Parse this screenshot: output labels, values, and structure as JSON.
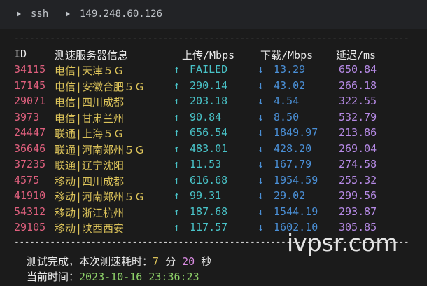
{
  "titlebar": {
    "app": "ssh",
    "host": "149.248.60.126"
  },
  "table": {
    "rule": "--------------------------------------------------------------------------------------",
    "headers": {
      "id": "ID",
      "node": "测速服务器信息",
      "upload": "上传/Mbps",
      "download": "下载/Mbps",
      "latency": "延迟/ms"
    },
    "up_arrow": "↑",
    "down_arrow": "↓",
    "rows": [
      {
        "id": "34115",
        "node": "电信|天津５Ｇ",
        "upload": "FAILED",
        "download": "13.29",
        "latency": "650.84"
      },
      {
        "id": "17145",
        "node": "电信|安徽合肥５Ｇ",
        "upload": "290.14",
        "download": "43.02",
        "latency": "266.18"
      },
      {
        "id": "29071",
        "node": "电信|四川成都",
        "upload": "203.18",
        "download": "4.54",
        "latency": "322.55"
      },
      {
        "id": "3973",
        "node": "电信|甘肃兰州",
        "upload": "90.84",
        "download": "8.50",
        "latency": "532.79"
      },
      {
        "id": "24447",
        "node": "联通|上海５Ｇ",
        "upload": "656.54",
        "download": "1849.97",
        "latency": "213.86"
      },
      {
        "id": "36646",
        "node": "联通|河南郑州５Ｇ",
        "upload": "483.01",
        "download": "428.20",
        "latency": "269.04"
      },
      {
        "id": "37235",
        "node": "联通|辽宁沈阳",
        "upload": "11.53",
        "download": "167.79",
        "latency": "274.58"
      },
      {
        "id": "4575",
        "node": "移动|四川成都",
        "upload": "616.68",
        "download": "1954.59",
        "latency": "255.32"
      },
      {
        "id": "41910",
        "node": "移动|河南郑州５Ｇ",
        "upload": "99.31",
        "download": "29.02",
        "latency": "299.56"
      },
      {
        "id": "54312",
        "node": "移动|浙江杭州",
        "upload": "187.68",
        "download": "1544.19",
        "latency": "293.87"
      },
      {
        "id": "29105",
        "node": "移动|陕西西安",
        "upload": "117.57",
        "download": "1602.10",
        "latency": "305.85"
      }
    ]
  },
  "footer": {
    "done_label": "测试完成，本次测速耗时：",
    "minutes": "7",
    "min_unit": "分",
    "seconds": "20",
    "sec_unit": "秒",
    "time_label": "当前时间：",
    "datetime": "2023-10-16 23:36:23"
  },
  "watermark": "ivpsr.com",
  "colors": {
    "id": "#e0607e",
    "node": "#dcc35a",
    "upload": "#49c3c8",
    "download": "#4a8fd6",
    "latency": "#b68ae6"
  }
}
